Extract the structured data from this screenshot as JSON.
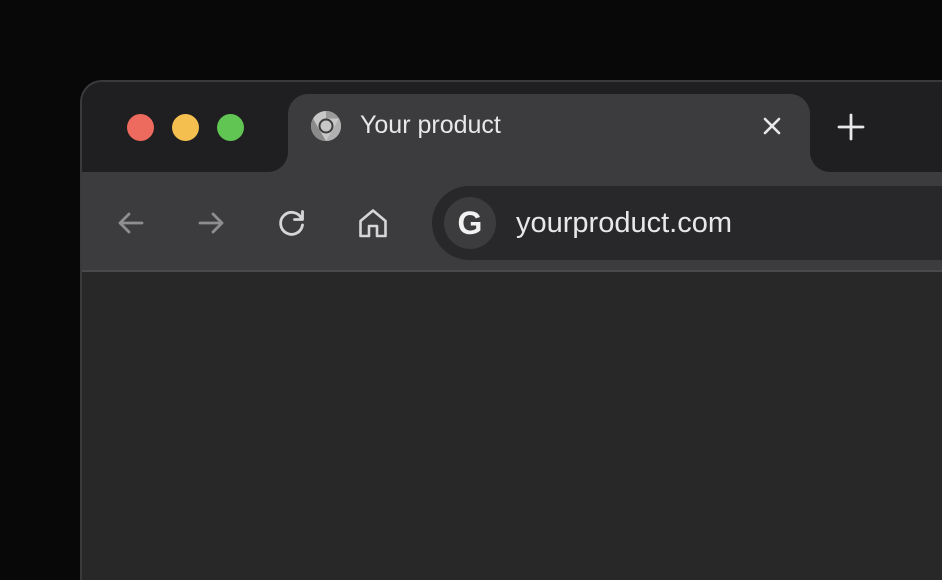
{
  "window": {
    "traffic_lights": [
      {
        "name": "close",
        "color": "#ed6a5e"
      },
      {
        "name": "minimize",
        "color": "#f5bf4f"
      },
      {
        "name": "maximize",
        "color": "#61c554"
      }
    ]
  },
  "tab": {
    "favicon": "chrome-icon",
    "title": "Your product",
    "close_icon": "close-icon"
  },
  "new_tab": {
    "icon": "plus-icon"
  },
  "toolbar": {
    "back_icon": "arrow-left-icon",
    "forward_icon": "arrow-right-icon",
    "reload_icon": "reload-icon",
    "home_icon": "home-icon"
  },
  "omnibox": {
    "site_icon_letter": "G",
    "url": "yourproduct.com"
  },
  "colors": {
    "background": "#080808",
    "titlebar": "#1f1f21",
    "tab_active": "#3c3c3e",
    "toolbar": "#3c3c3e",
    "omnibox": "#28282a",
    "content": "#282828",
    "text": "#e8e8ea"
  }
}
